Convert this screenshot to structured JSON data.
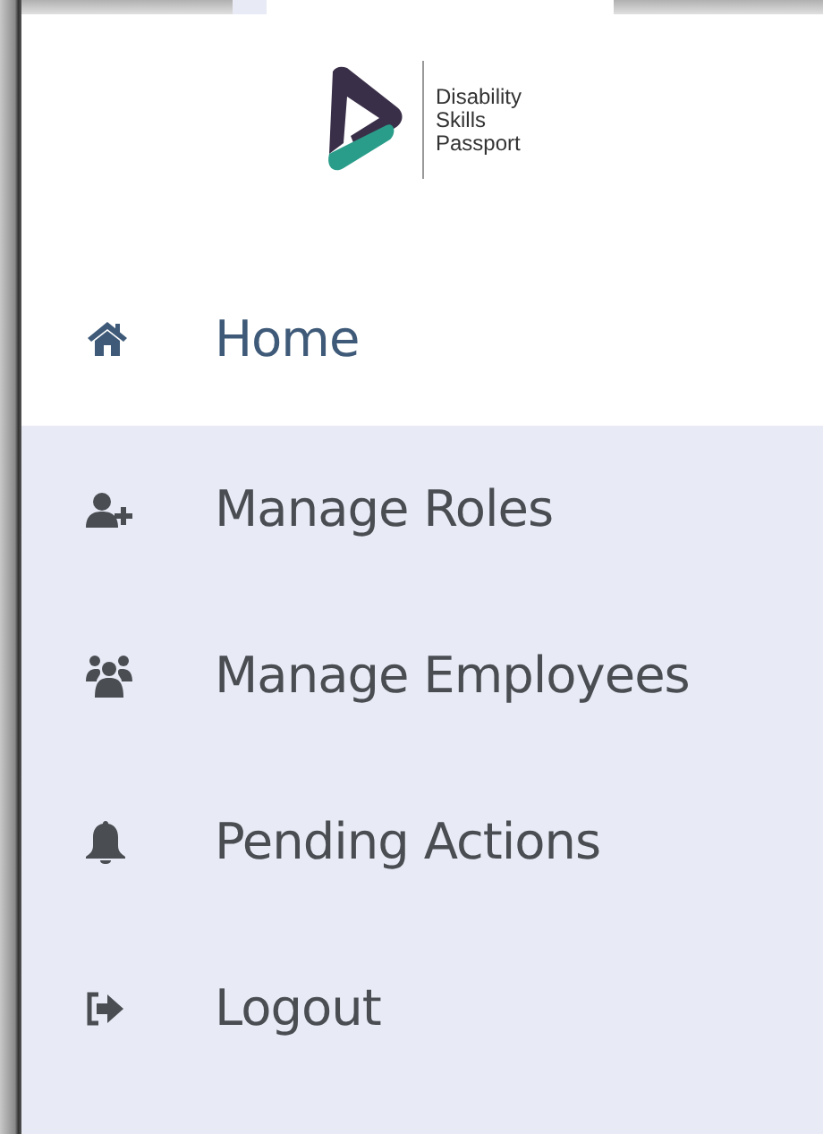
{
  "logo": {
    "lines": [
      "Disability",
      "Skills",
      "Passport"
    ]
  },
  "menu": [
    {
      "label": "Home",
      "selected": true
    },
    {
      "label": "Manage Roles",
      "selected": false
    },
    {
      "label": "Manage Employees",
      "selected": false
    },
    {
      "label": "Pending Actions",
      "selected": false
    },
    {
      "label": "Logout",
      "selected": false
    }
  ]
}
